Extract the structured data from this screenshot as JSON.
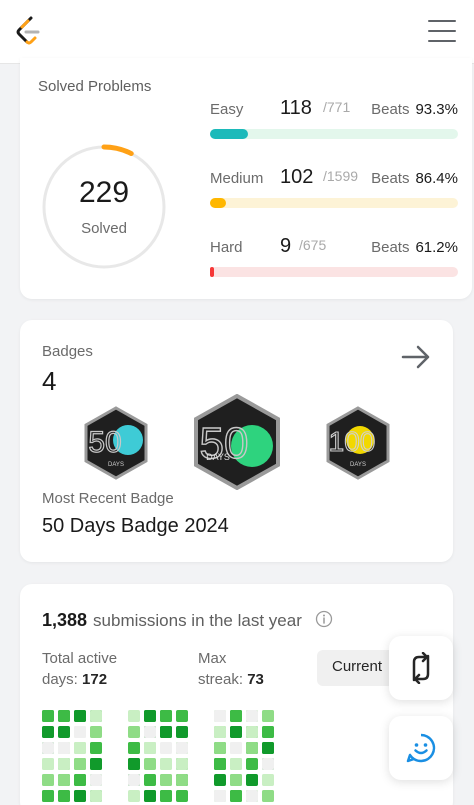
{
  "colors": {
    "easy": "#1cbaba",
    "easy_track": "#e3f7ec",
    "medium": "#ffb700",
    "medium_track": "#fdf3d6",
    "hard": "#f63737",
    "hard_track": "#fbe3e3",
    "ring_progress": "#ffa116",
    "ring_track": "#e8e8e8",
    "heat": [
      "#f0f0f0",
      "#c9efc3",
      "#8fdc86",
      "#3dbb45",
      "#119a2b"
    ]
  },
  "solved": {
    "title": "Solved Problems",
    "total": "229",
    "total_label": "Solved",
    "ring_fraction": 0.075,
    "difficulties": [
      {
        "name": "Easy",
        "count": "118",
        "total": "/771",
        "beats_label": "Beats",
        "beats_value": "93.3%",
        "fraction": 0.153
      },
      {
        "name": "Medium",
        "count": "102",
        "total": "/1599",
        "beats_label": "Beats",
        "beats_value": "86.4%",
        "fraction": 0.064
      },
      {
        "name": "Hard",
        "count": "9",
        "total": "/675",
        "beats_label": "Beats",
        "beats_value": "61.2%",
        "fraction": 0.013
      }
    ]
  },
  "badges": {
    "title": "Badges",
    "count": "4",
    "items": [
      {
        "name": "50-days-badge",
        "digits": "50",
        "caption": "DAYS",
        "color": "#3ecbd6"
      },
      {
        "name": "50-days-badge-2024",
        "digits": "50",
        "caption": "DAYS",
        "color": "#2ed37e"
      },
      {
        "name": "100-days-badge",
        "digits": "100",
        "caption": "DAYS",
        "color": "#f2d800"
      }
    ],
    "recent_label": "Most Recent Badge",
    "recent_name": "50 Days Badge 2024"
  },
  "submissions": {
    "count": "1,388",
    "text": "submissions in the last year",
    "active_label_1": "Total active",
    "active_label_2": "days:",
    "active_value": "172",
    "streak_label_1": "Max",
    "streak_label_2": "streak:",
    "streak_value": "73",
    "current_label": "Current"
  },
  "heatmap": [
    [
      [
        4,
        4,
        3,
        3
      ],
      [
        0,
        1,
        1,
        2
      ],
      [
        1,
        3,
        0,
        4
      ]
    ],
    [
      [
        2,
        3,
        2,
        1
      ],
      [
        0,
        2,
        1,
        2
      ],
      [
        1,
        2,
        0,
        3
      ]
    ],
    [
      [
        3,
        2,
        2,
        3
      ],
      [
        1,
        3,
        1,
        0
      ],
      [
        0,
        2,
        3,
        4
      ]
    ]
  ]
}
